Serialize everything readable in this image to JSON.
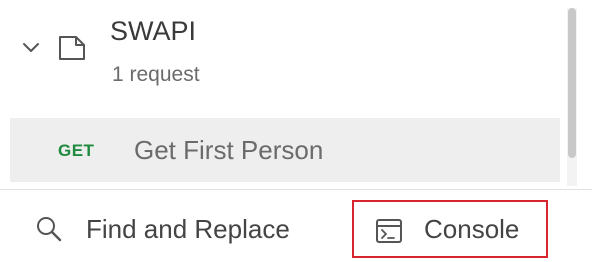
{
  "collection": {
    "name": "SWAPI",
    "request_count": "1 request",
    "expanded": true,
    "icons": {
      "chevron": "chevron-down-icon",
      "folder": "collection-folder-icon"
    }
  },
  "requests": [
    {
      "method": "GET",
      "name": "Get First Person",
      "method_color": "#1f8a3f",
      "selected": true
    }
  ],
  "footer": {
    "find_replace": {
      "label": "Find and Replace",
      "icon": "search-icon"
    },
    "console": {
      "label": "Console",
      "icon": "console-icon",
      "highlight_color": "#d9262e"
    }
  }
}
